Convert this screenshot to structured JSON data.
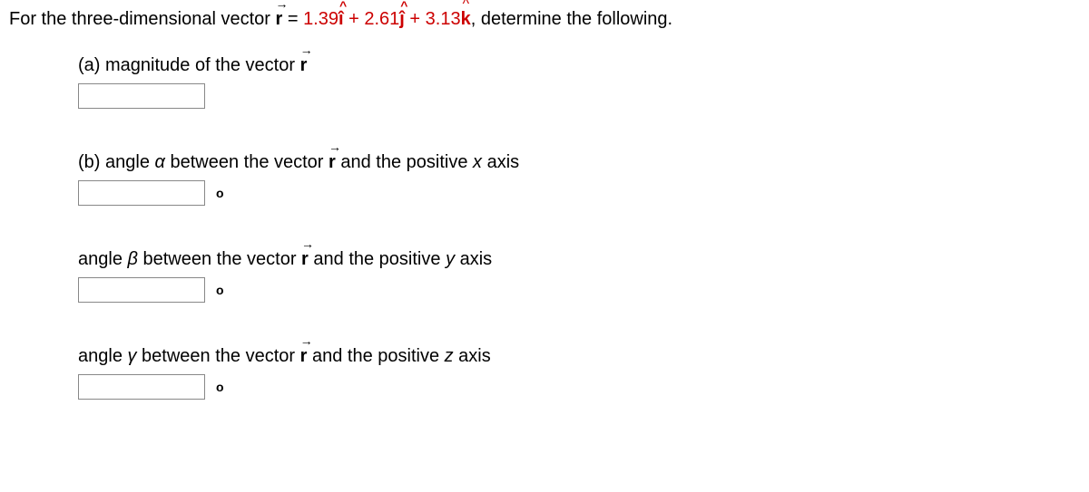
{
  "intro": {
    "prefix": "For the three-dimensional vector  ",
    "equals": " = ",
    "coef_i": "1.39",
    "coef_j": "2.61",
    "coef_k": "3.13",
    "plus1": " + ",
    "plus2": " + ",
    "comma": ",",
    "suffix": "  determine the following."
  },
  "parts": {
    "a": {
      "label_prefix": "(a) magnitude of the vector  "
    },
    "b": {
      "label_prefix": "(b) angle ",
      "alpha": "α",
      "label_mid": " between the vector  ",
      "label_suffix": "  and the positive ",
      "axis": "x",
      "label_end": " axis",
      "unit": "o"
    },
    "beta": {
      "label_prefix": "angle ",
      "beta": "β",
      "label_mid": " between the vector  ",
      "label_suffix": "  and the positive ",
      "axis": "y",
      "label_end": " axis",
      "unit": "o"
    },
    "gamma": {
      "label_prefix": "angle ",
      "gamma": "γ",
      "label_mid": " between the vector  ",
      "label_suffix": "  and the positive ",
      "axis": "z",
      "label_end": " axis",
      "unit": "o"
    }
  }
}
